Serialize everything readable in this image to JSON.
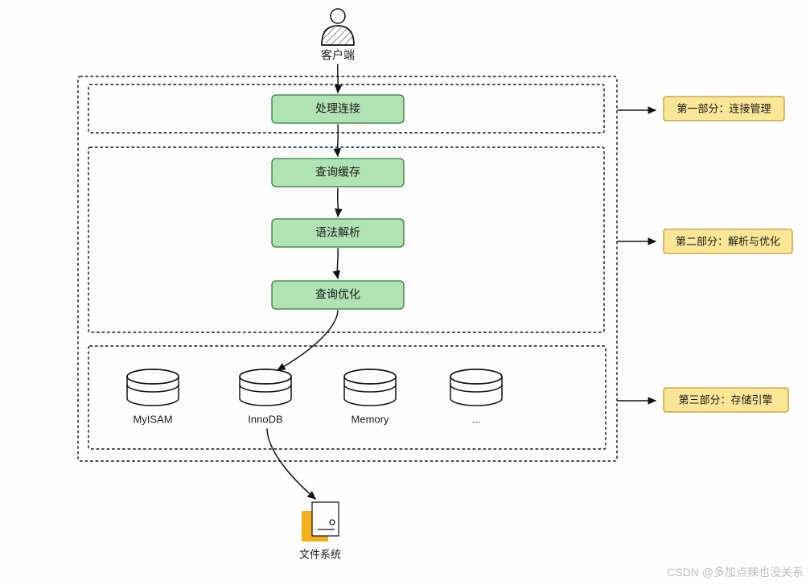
{
  "client": {
    "label": "客户端"
  },
  "part1": {
    "caption": "第一部分：连接管理",
    "boxes": [
      {
        "label": "处理连接"
      }
    ]
  },
  "part2": {
    "caption": "第二部分：解析与优化",
    "boxes": [
      {
        "label": "查询缓存"
      },
      {
        "label": "语法解析"
      },
      {
        "label": "查询优化"
      }
    ]
  },
  "part3": {
    "caption": "第三部分：存储引擎",
    "engines": [
      {
        "label": "MyISAM"
      },
      {
        "label": "InnoDB"
      },
      {
        "label": "Memory"
      },
      {
        "label": "..."
      }
    ]
  },
  "filesystem": {
    "label": "文件系统"
  },
  "watermark": "CSDN @多加点辣也没关系",
  "colors": {
    "green_fill": "#b1e2b4",
    "green_stroke": "#2f7a3a",
    "yellow_fill": "#fbe697",
    "yellow_stroke": "#c29a2e",
    "file_fill": "#f4b01c"
  }
}
